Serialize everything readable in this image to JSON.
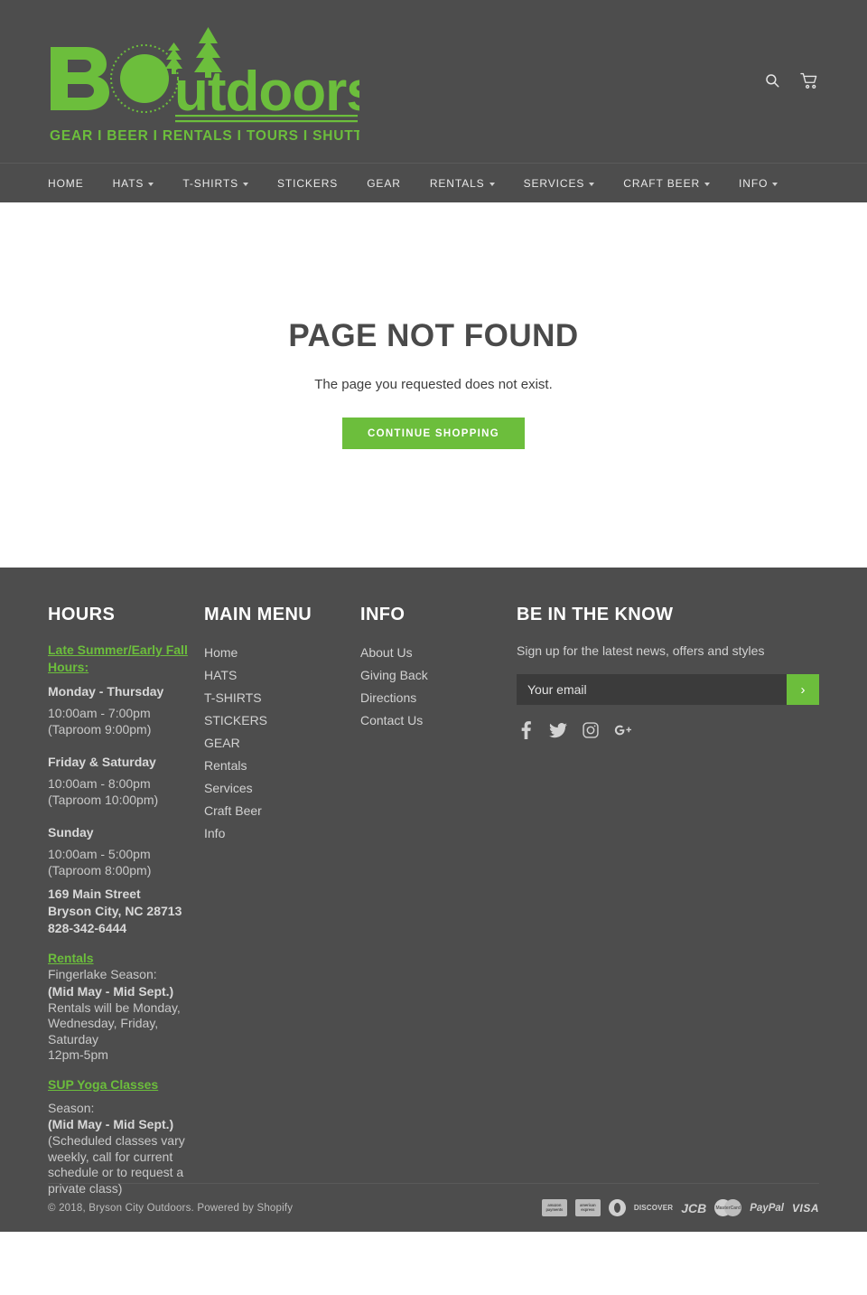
{
  "header": {
    "logo": {
      "brand_primary": "BC",
      "brand_secondary": "utdoors",
      "tagline": "GEAR I BEER I RENTALS I TOURS I SHUTTLE",
      "alt": "Bryson City Outdoors"
    },
    "icons": {
      "search": "search-icon",
      "cart": "cart-icon"
    },
    "colors": {
      "background": "#4d4d4d",
      "brand_green": "#6cbe3c"
    }
  },
  "nav": {
    "items": [
      {
        "label": "HOME",
        "has_dropdown": false
      },
      {
        "label": "HATS",
        "has_dropdown": true
      },
      {
        "label": "T-SHIRTS",
        "has_dropdown": true
      },
      {
        "label": "STICKERS",
        "has_dropdown": false
      },
      {
        "label": "GEAR",
        "has_dropdown": false
      },
      {
        "label": "RENTALS",
        "has_dropdown": true
      },
      {
        "label": "SERVICES",
        "has_dropdown": true
      },
      {
        "label": "CRAFT BEER",
        "has_dropdown": true
      },
      {
        "label": "INFO",
        "has_dropdown": true
      }
    ]
  },
  "main": {
    "title": "PAGE NOT FOUND",
    "subtitle": "The page you requested does not exist.",
    "cta_label": "Continue shopping"
  },
  "footer": {
    "hours": {
      "title": "HOURS",
      "link_1": "Late Summer/Early Fall Hours:",
      "day_1": "Monday - Thursday",
      "time_1a": "10:00am - 7:00pm",
      "time_1b": "(Taproom 9:00pm)",
      "day_2": "Friday & Saturday",
      "time_2a": "10:00am - 8:00pm",
      "time_2b": "(Taproom 10:00pm)",
      "day_3": "Sunday",
      "time_3a": "10:00am - 5:00pm",
      "time_3b": "(Taproom 8:00pm)",
      "address_1": "169 Main Street",
      "address_2": "Bryson City, NC 28713",
      "phone": "828-342-6444",
      "rentals_link": "Rentals",
      "rentals_1": "Fingerlake Season:",
      "rentals_2": "(Mid May - Mid Sept.)",
      "rentals_3": "Rentals will be Monday,",
      "rentals_4": "Wednesday, Friday,",
      "rentals_5": "Saturday",
      "rentals_6": "12pm-5pm",
      "sup_link": "SUP Yoga Classes",
      "sup_1": "Season:",
      "sup_2": "(Mid May - Mid Sept.)",
      "sup_3": "(Scheduled classes vary",
      "sup_4": "weekly, call for current",
      "sup_5": "schedule or to request a",
      "sup_6": "private class)"
    },
    "main_menu": {
      "title": "MAIN MENU",
      "items": [
        "Home",
        "HATS",
        "T-SHIRTS",
        "STICKERS",
        "GEAR",
        "Rentals",
        "Services",
        "Craft Beer",
        "Info"
      ]
    },
    "info": {
      "title": "INFO",
      "items": [
        "About Us",
        "Giving Back",
        "Directions",
        "Contact Us"
      ]
    },
    "newsletter": {
      "title": "BE IN THE KNOW",
      "subtitle": "Sign up for the latest news, offers and styles",
      "placeholder": "Your email",
      "value": "",
      "submit_label": "›"
    },
    "social": [
      {
        "name": "facebook-icon",
        "label": "Facebook"
      },
      {
        "name": "twitter-icon",
        "label": "Twitter"
      },
      {
        "name": "instagram-icon",
        "label": "Instagram"
      },
      {
        "name": "google-plus-icon",
        "label": "Google Plus"
      }
    ],
    "bottom": {
      "copyright": "© 2018, Bryson City Outdoors. Powered by Shopify",
      "payment_methods": [
        "amazon payments",
        "american express",
        "diners club",
        "DISCOVER",
        "JCB",
        "MasterCard",
        "PayPal",
        "VISA"
      ]
    }
  }
}
